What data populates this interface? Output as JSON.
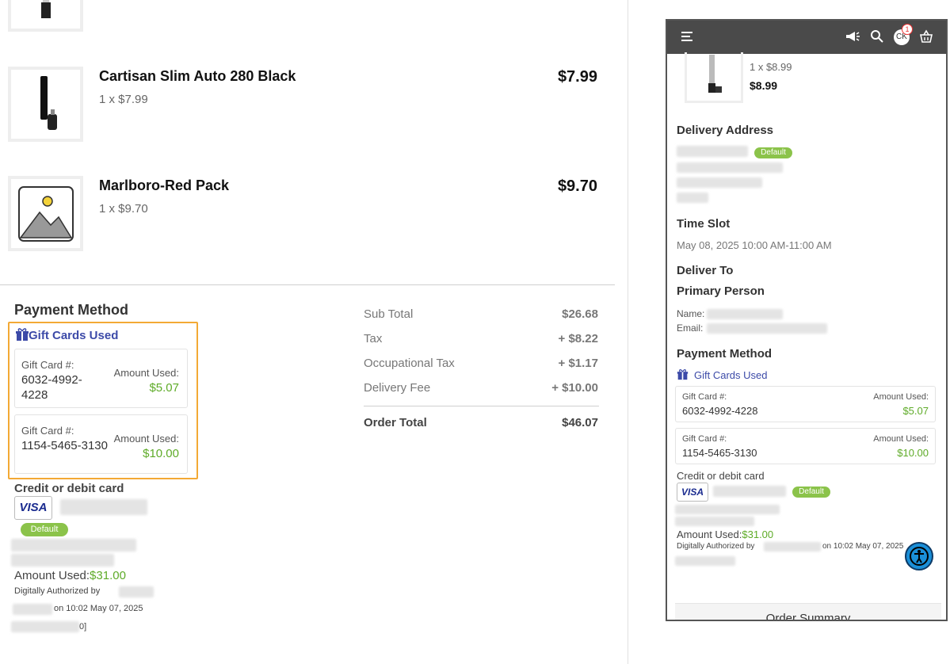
{
  "products": [
    {
      "name": "Cartisan Slim Auto 280 Black",
      "qty": "1 x $7.99",
      "price": "$7.99"
    },
    {
      "name": "Marlboro-Red Pack",
      "qty": "1 x $9.70",
      "price": "$9.70"
    }
  ],
  "payment": {
    "heading": "Payment Method",
    "gift_title": "Gift Cards Used",
    "gift_cards": [
      {
        "label": "Gift Card #:",
        "number": "6032-4992-4228",
        "amount_label": "Amount Used:",
        "amount": "$5.07"
      },
      {
        "label": "Gift Card #:",
        "number": "1154-5465-3130",
        "amount_label": "Amount Used:",
        "amount": "$10.00"
      }
    ],
    "card_title": "Credit or debit card",
    "visa": "VISA",
    "default_badge": "Default",
    "amount_used_label": "Amount Used:",
    "amount_used_value": "$31.00",
    "auth_prefix": "Digitally Authorized by",
    "auth_suffix": "on 10:02 May 07, 2025",
    "auth_end": "0]"
  },
  "summary": {
    "rows": [
      {
        "label": "Sub Total",
        "value": "$26.68"
      },
      {
        "label": "Tax",
        "value": "+ $8.22"
      },
      {
        "label": "Occupational Tax",
        "value": "+ $1.17"
      },
      {
        "label": "Delivery Fee",
        "value": "+ $10.00"
      }
    ],
    "total_label": "Order Total",
    "total_value": "$46.07"
  },
  "phone": {
    "cart_count": "1",
    "avatar": "CK",
    "item_qty": "1 x $8.99",
    "item_price": "$8.99",
    "delivery_address": "Delivery Address",
    "default_badge": "Default",
    "time_slot": "Time Slot",
    "time_value": "May 08, 2025 10:00 AM-11:00 AM",
    "deliver_to": "Deliver To",
    "primary_person": "Primary Person",
    "name_label": "Name:",
    "email_label": "Email:",
    "payment_method": "Payment Method",
    "gift_title": "Gift Cards Used",
    "gift_cards": [
      {
        "label": "Gift Card #:",
        "number": "6032-4992-4228",
        "amount_label": "Amount Used:",
        "amount": "$5.07"
      },
      {
        "label": "Gift Card #:",
        "number": "1154-5465-3130",
        "amount_label": "Amount Used:",
        "amount": "$10.00"
      }
    ],
    "card_title": "Credit or debit card",
    "visa": "VISA",
    "amount_used_label": "Amount Used:",
    "amount_used_value": "$31.00",
    "auth_prefix": "Digitally Authorized by",
    "auth_suffix": "on 10:02 May 07, 2025",
    "order_summary": "Order Summary"
  },
  "colors": {
    "accent_green": "#5eab28",
    "gift_blue": "#3c4aa8",
    "highlight": "#f3a935",
    "topbar": "#4a4a4a"
  }
}
